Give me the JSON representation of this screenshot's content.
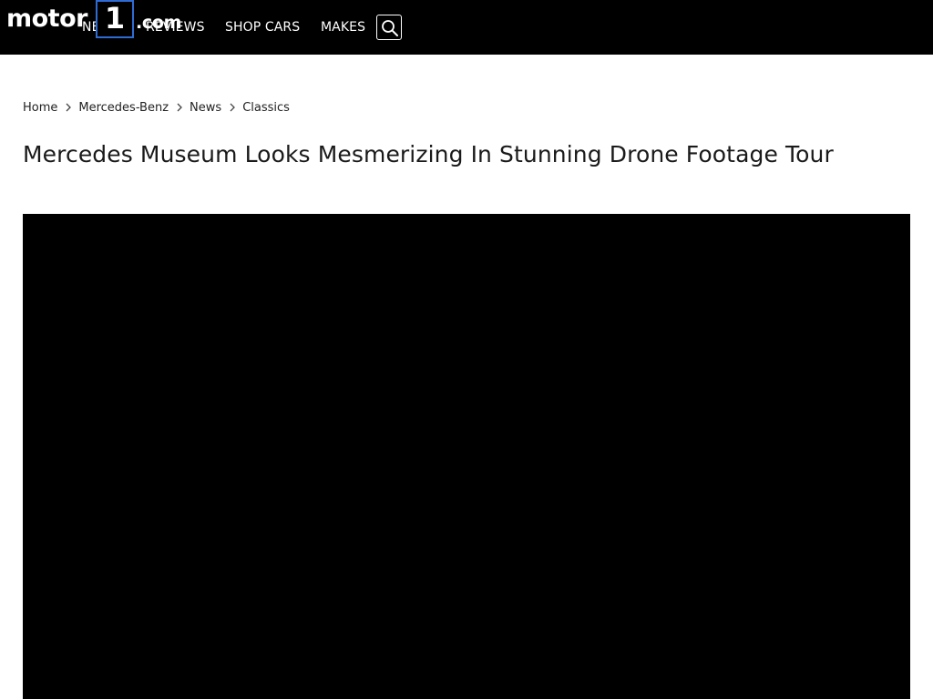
{
  "site": {
    "logo": {
      "word": "motor",
      "numeral": "1",
      "suffix": ".com",
      "box_color": "#2f6bd3"
    }
  },
  "nav": {
    "items": [
      {
        "label": "NEWS"
      },
      {
        "label": "REVIEWS"
      },
      {
        "label": "SHOP CARS"
      },
      {
        "label": "MAKES"
      }
    ],
    "search_icon": "search-icon"
  },
  "breadcrumb": {
    "items": [
      {
        "label": "Home"
      },
      {
        "label": "Mercedes-Benz"
      },
      {
        "label": "News"
      },
      {
        "label": "Classics"
      }
    ],
    "separator_icon": "chevron-right-icon"
  },
  "article": {
    "title": "Mercedes Museum Looks Mesmerizing In Stunning Drone Footage Tour"
  },
  "colors": {
    "topbar_background": "#000000",
    "video_background": "#000000",
    "text": "#1a1a1a"
  }
}
